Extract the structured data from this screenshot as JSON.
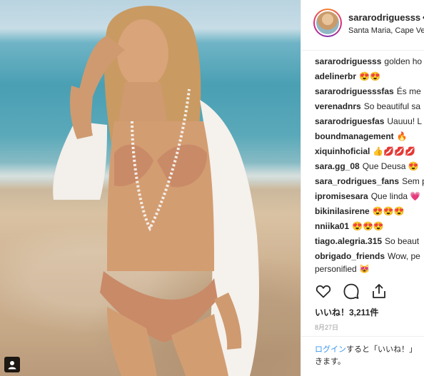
{
  "post": {
    "username": "sararodriguesss",
    "separator": "•",
    "location": "Santa Maria, Cape Ve",
    "comments": [
      {
        "user": "sararodriguesss",
        "text": "golden ho"
      },
      {
        "user": "adelinerbr",
        "text": "😍😍"
      },
      {
        "user": "sararodriguesssfas",
        "text": "És me"
      },
      {
        "user": "verenadnrs",
        "text": "So beautiful sa"
      },
      {
        "user": "sararodriguesfas",
        "text": "Uauuu! L"
      },
      {
        "user": "boundmanagement",
        "text": "🔥"
      },
      {
        "user": "xiquinhoficial",
        "text": "👍💋💋💋"
      },
      {
        "user": "sara.gg_08",
        "text": "Que Deusa 😍"
      },
      {
        "user": "sara_rodrigues_fans",
        "text": "Sem p"
      },
      {
        "user": "ipromisesara",
        "text": "Que linda 💗"
      },
      {
        "user": "bikinilasirene",
        "text": "😍😍😍"
      },
      {
        "user": "nniika01",
        "text": "😍😍😍"
      },
      {
        "user": "tiago.alegria.315",
        "text": "So beaut"
      },
      {
        "user": "obrigado_friends",
        "text": "Wow, pe"
      },
      {
        "user": "",
        "text": "personified 😻"
      }
    ],
    "actions": {
      "like_icon": "heart-icon",
      "comment_icon": "comment-icon",
      "share_icon": "share-icon"
    },
    "likes_text": "いいね！3,211件",
    "date": "8月27日",
    "login_link": "ログイン",
    "login_text_1": "すると「いいね！」",
    "login_text_2": "きます。",
    "photo_badge_icon": "user-tag-icon"
  },
  "colors": {
    "link": "#3897f0",
    "text": "#262626",
    "muted": "#999999"
  }
}
